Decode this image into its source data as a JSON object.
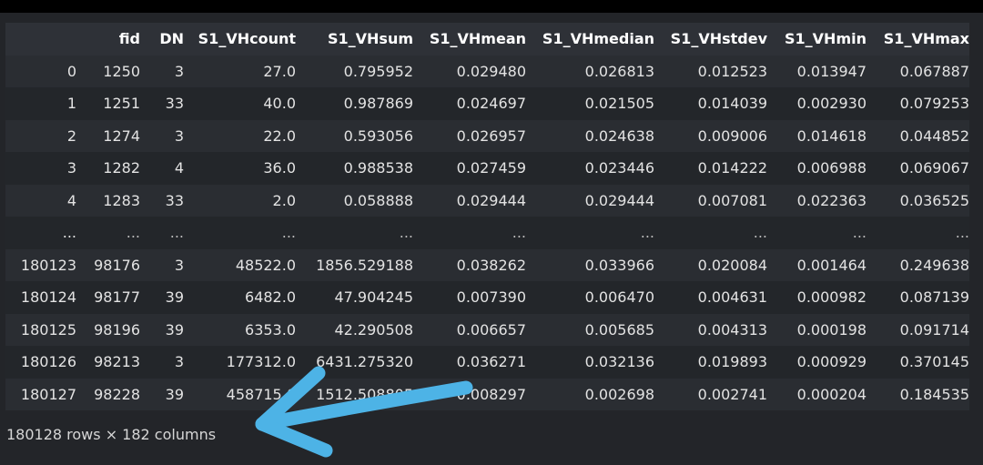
{
  "table": {
    "columns": [
      "",
      "fid",
      "DN",
      "S1_VHcount",
      "S1_VHsum",
      "S1_VHmean",
      "S1_VHmedian",
      "S1_VHstdev",
      "S1_VHmin",
      "S1_VHmax"
    ],
    "rows": [
      [
        "0",
        "1250",
        "3",
        "27.0",
        "0.795952",
        "0.029480",
        "0.026813",
        "0.012523",
        "0.013947",
        "0.067887"
      ],
      [
        "1",
        "1251",
        "33",
        "40.0",
        "0.987869",
        "0.024697",
        "0.021505",
        "0.014039",
        "0.002930",
        "0.079253"
      ],
      [
        "2",
        "1274",
        "3",
        "22.0",
        "0.593056",
        "0.026957",
        "0.024638",
        "0.009006",
        "0.014618",
        "0.044852"
      ],
      [
        "3",
        "1282",
        "4",
        "36.0",
        "0.988538",
        "0.027459",
        "0.023446",
        "0.014222",
        "0.006988",
        "0.069067"
      ],
      [
        "4",
        "1283",
        "33",
        "2.0",
        "0.058888",
        "0.029444",
        "0.029444",
        "0.007081",
        "0.022363",
        "0.036525"
      ],
      [
        "...",
        "...",
        "...",
        "...",
        "...",
        "...",
        "...",
        "...",
        "...",
        "..."
      ],
      [
        "180123",
        "98176",
        "3",
        "48522.0",
        "1856.529188",
        "0.038262",
        "0.033966",
        "0.020084",
        "0.001464",
        "0.249638"
      ],
      [
        "180124",
        "98177",
        "39",
        "6482.0",
        "47.904245",
        "0.007390",
        "0.006470",
        "0.004631",
        "0.000982",
        "0.087139"
      ],
      [
        "180125",
        "98196",
        "39",
        "6353.0",
        "42.290508",
        "0.006657",
        "0.005685",
        "0.004313",
        "0.000198",
        "0.091714"
      ],
      [
        "180126",
        "98213",
        "3",
        "177312.0",
        "6431.275320",
        "0.036271",
        "0.032136",
        "0.019893",
        "0.000929",
        "0.370145"
      ],
      [
        "180127",
        "98228",
        "39",
        "458715.0",
        "1512.508805",
        "0.008297",
        "0.002698",
        "0.002741",
        "0.000204",
        "0.184535"
      ]
    ]
  },
  "footer": "180128 rows × 182 columns",
  "colors": {
    "arrow": "#4db3e6"
  }
}
